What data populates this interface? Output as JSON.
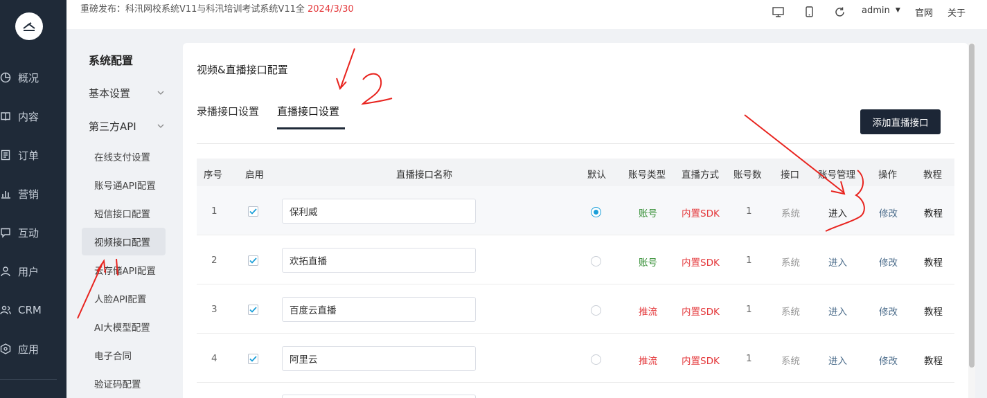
{
  "nav": {
    "items": [
      {
        "label": "概况",
        "icon": "pie-chart-icon"
      },
      {
        "label": "内容",
        "icon": "book-icon"
      },
      {
        "label": "订单",
        "icon": "order-icon"
      },
      {
        "label": "营销",
        "icon": "bar-chart-icon"
      },
      {
        "label": "互动",
        "icon": "chat-icon"
      },
      {
        "label": "用户",
        "icon": "user-icon"
      },
      {
        "label": "CRM",
        "icon": "crm-icon"
      },
      {
        "label": "应用",
        "icon": "app-icon"
      }
    ]
  },
  "topbar": {
    "announcement": "重磅发布：科汛网校系统V11与科汛培训考试系统V11全",
    "announcement_date": "2024/3/30",
    "user": "admin",
    "link_site": "官网",
    "link_about": "关于"
  },
  "sub": {
    "title": "系统配置",
    "groups": [
      "基本设置",
      "第三方API"
    ],
    "items": [
      "在线支付设置",
      "账号通API配置",
      "短信接口配置",
      "视频接口配置",
      "云存储API配置",
      "人脸API配置",
      "AI大模型配置",
      "电子合同",
      "验证码配置"
    ]
  },
  "main": {
    "title": "视频&直播接口配置",
    "tabs": [
      "录播接口设置",
      "直播接口设置"
    ],
    "add_button": "添加直播接口"
  },
  "table": {
    "headers": [
      "序号",
      "启用",
      "直播接口名称",
      "默认",
      "账号类型",
      "直播方式",
      "账号数",
      "接口",
      "账号管理",
      "操作",
      "教程"
    ],
    "rows": [
      {
        "no": "1",
        "name": "保利威",
        "account_type": "账号",
        "mode": "内置SDK",
        "count": "1",
        "iface": "系统",
        "manage": "进入",
        "op": "修改",
        "tutorial": "教程"
      },
      {
        "no": "2",
        "name": "欢拓直播",
        "account_type": "账号",
        "mode": "内置SDK",
        "count": "1",
        "iface": "系统",
        "manage": "进入",
        "op": "修改",
        "tutorial": "教程"
      },
      {
        "no": "3",
        "name": "百度云直播",
        "account_type": "推流",
        "mode": "内置SDK",
        "count": "1",
        "iface": "系统",
        "manage": "进入",
        "op": "修改",
        "tutorial": "教程"
      },
      {
        "no": "4",
        "name": "阿里云",
        "account_type": "推流",
        "mode": "内置SDK",
        "count": "1",
        "iface": "系统",
        "manage": "进入",
        "op": "修改",
        "tutorial": "教程"
      }
    ]
  },
  "colors": {
    "nav_bg": "#1f2a38",
    "accent_red": "#e4393c",
    "green": "#2e8b2e",
    "radio_blue": "#1a9fd9",
    "annotation_red": "#e8231e"
  }
}
